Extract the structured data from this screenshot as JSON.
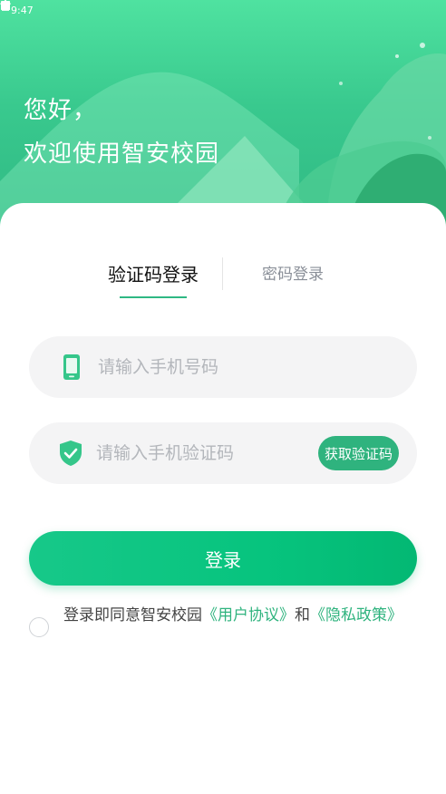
{
  "status_bar": {
    "time": "9:47",
    "left_icons": [
      "download-icon",
      "download-icon",
      "image-notification-icon"
    ],
    "right_icons": [
      "wifi-icon",
      "signal-icon",
      "battery-icon"
    ]
  },
  "header": {
    "greeting_line1": "您好，",
    "greeting_line2": "欢迎使用智安校园"
  },
  "tabs": {
    "sms_login": "验证码登录",
    "password_login": "密码登录",
    "active": "sms_login"
  },
  "phone_field": {
    "placeholder": "请输入手机号码",
    "value": "",
    "icon": "phone-icon"
  },
  "code_field": {
    "placeholder": "请输入手机验证码",
    "value": "",
    "icon": "shield-check-icon",
    "get_code_label": "获取验证码"
  },
  "login_button": {
    "label": "登录"
  },
  "agreement": {
    "prefix": "登录即同意智安校园",
    "user_agreement": "《用户协议》",
    "and": "和",
    "privacy_policy": "《隐私政策》",
    "checked": false
  },
  "colors": {
    "accent": "#2fb37e",
    "header_top": "#4fe2a0",
    "header_bottom": "#2fb883",
    "input_bg": "#f4f4f5"
  }
}
